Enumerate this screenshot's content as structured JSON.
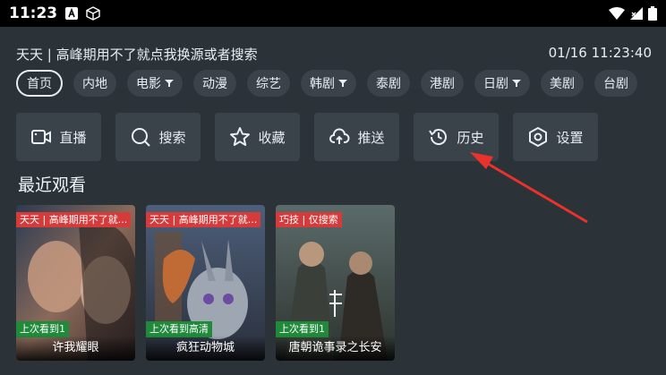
{
  "status_bar": {
    "time": "11:23",
    "icons": [
      "notification-a-icon",
      "cube-icon",
      "wifi-icon",
      "signal-icon",
      "battery-icon"
    ]
  },
  "header": {
    "notice": "天天 | 高峰期用不了就点我换源或者搜索",
    "datetime": "01/16 11:23:40"
  },
  "tabs": [
    {
      "label": "首页",
      "active": true,
      "filter": false
    },
    {
      "label": "内地",
      "filter": false
    },
    {
      "label": "电影",
      "filter": true
    },
    {
      "label": "动漫",
      "filter": false
    },
    {
      "label": "综艺",
      "filter": false
    },
    {
      "label": "韩剧",
      "filter": true
    },
    {
      "label": "泰剧",
      "filter": false
    },
    {
      "label": "港剧",
      "filter": false
    },
    {
      "label": "日剧",
      "filter": true
    },
    {
      "label": "美剧",
      "filter": false
    },
    {
      "label": "台剧",
      "filter": false
    }
  ],
  "actions": [
    {
      "label": "直播",
      "icon": "video-camera-icon"
    },
    {
      "label": "搜索",
      "icon": "search-icon"
    },
    {
      "label": "收藏",
      "icon": "star-icon"
    },
    {
      "label": "推送",
      "icon": "cloud-upload-icon"
    },
    {
      "label": "历史",
      "icon": "history-icon"
    },
    {
      "label": "设置",
      "icon": "settings-hexagon-icon"
    }
  ],
  "recent": {
    "title": "最近观看",
    "items": [
      {
        "badge": "天天 | 高峰期用不了就...",
        "progress": "上次看到1",
        "title": "许我耀眼"
      },
      {
        "badge": "天天 | 高峰期用不了就...",
        "progress": "上次看到高清",
        "title": "疯狂动物城"
      },
      {
        "badge": "巧技 | 仅搜索",
        "progress": "上次看到1",
        "title": "唐朝诡事录之长安"
      }
    ]
  },
  "colors": {
    "background": "#2b3238",
    "tile": "#3a434a",
    "badge_red": "#d63b3b",
    "progress_green": "#1f8a3a",
    "arrow_red": "#e8322b"
  }
}
